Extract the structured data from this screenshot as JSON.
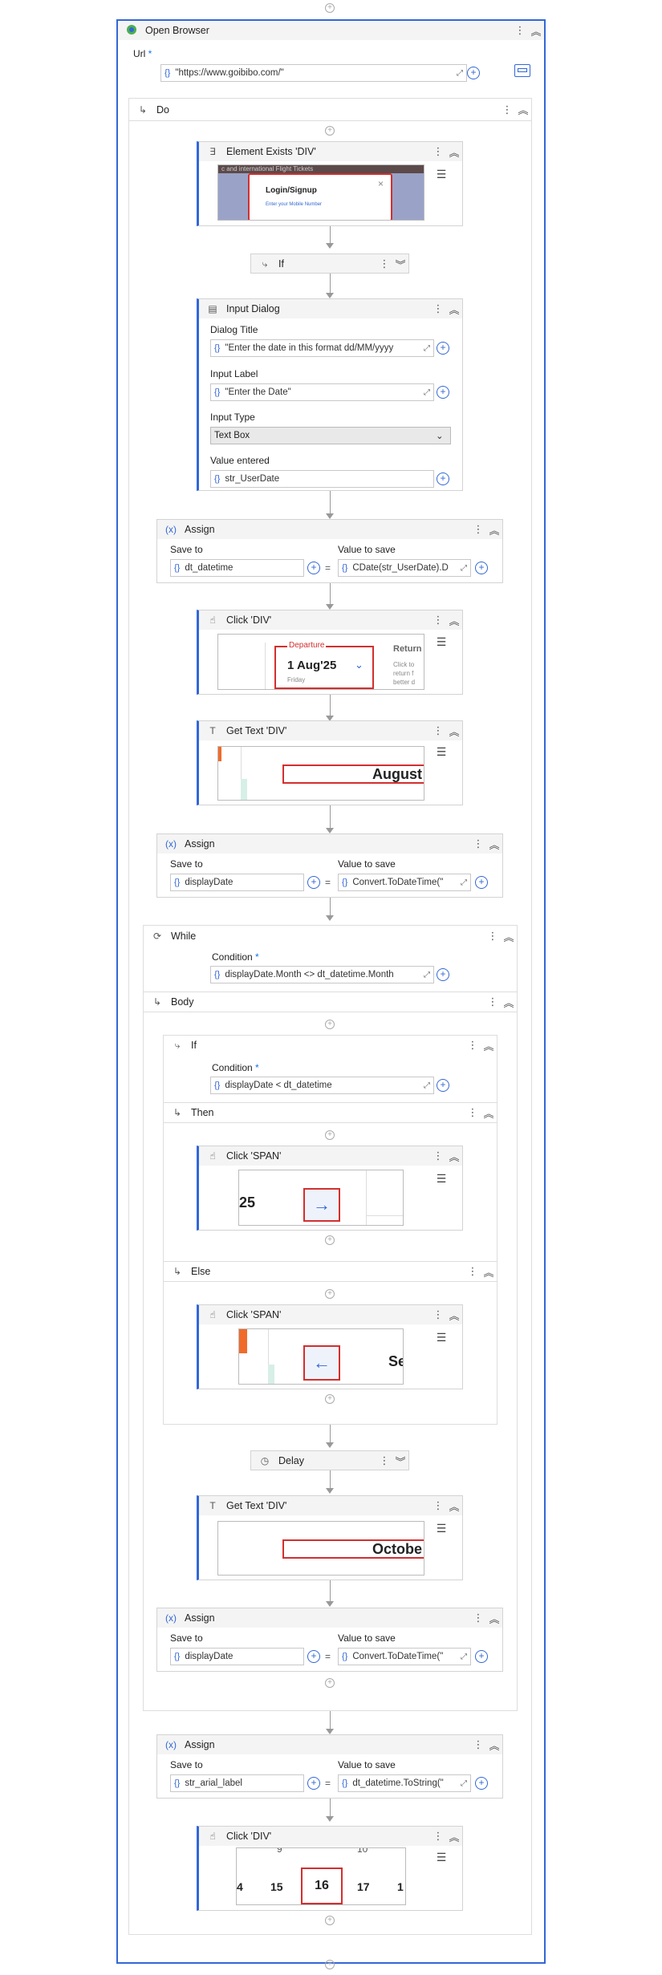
{
  "open_browser": {
    "title": "Open Browser",
    "url_label": "Url",
    "url_value": "\"https://www.goibibo.com/\""
  },
  "do_scope": {
    "label": "Do"
  },
  "element_exists": {
    "title": "Element Exists 'DIV'",
    "preview_login": "Login/Signup",
    "preview_mobile": "Enter your Mobile Number",
    "preview_banner": "c and international Flight Tickets"
  },
  "if1": {
    "title": "If"
  },
  "input_dialog": {
    "title": "Input Dialog",
    "dialog_title_label": "Dialog Title",
    "dialog_title_value": "\"Enter the date in this format dd/MM/yyyy",
    "input_label_label": "Input Label",
    "input_label_value": "\"Enter the Date\"",
    "input_type_label": "Input Type",
    "input_type_value": "Text Box",
    "value_entered_label": "Value entered",
    "value_entered_value": "str_UserDate"
  },
  "assign1": {
    "title": "Assign",
    "save_to_label": "Save to",
    "save_to_value": "dt_datetime",
    "value_label": "Value to save",
    "value_value": "CDate(str_UserDate).D"
  },
  "click_div1": {
    "title": "Click 'DIV'",
    "preview_departure": "Departure",
    "preview_date": "1 Aug'25",
    "preview_day": "Friday",
    "preview_return": "Return",
    "preview_return_sub": "Click to return f better d"
  },
  "get_text1": {
    "title": "Get Text 'DIV'",
    "preview_text": "August"
  },
  "assign2": {
    "title": "Assign",
    "save_to_label": "Save to",
    "save_to_value": "displayDate",
    "value_label": "Value to save",
    "value_value": "Convert.ToDateTime(\""
  },
  "while": {
    "title": "While",
    "condition_label": "Condition",
    "condition_value": "displayDate.Month <> dt_datetime.Month"
  },
  "body": {
    "label": "Body"
  },
  "if2": {
    "title": "If",
    "condition_label": "Condition",
    "condition_value": "displayDate < dt_datetime",
    "then_label": "Then",
    "else_label": "Else"
  },
  "click_span1": {
    "title": "Click 'SPAN'",
    "preview_text": "25"
  },
  "click_span2": {
    "title": "Click 'SPAN'",
    "preview_text": "Se"
  },
  "delay": {
    "title": "Delay"
  },
  "get_text2": {
    "title": "Get Text 'DIV'",
    "preview_text": "Octobe"
  },
  "assign3": {
    "title": "Assign",
    "save_to_label": "Save to",
    "save_to_value": "displayDate",
    "value_label": "Value to save",
    "value_value": "Convert.ToDateTime(\""
  },
  "assign4": {
    "title": "Assign",
    "save_to_label": "Save to",
    "save_to_value": "str_arial_label",
    "value_label": "Value to save",
    "value_value": "dt_datetime.ToString(\""
  },
  "click_div2": {
    "title": "Click 'DIV'",
    "preview_nums": [
      "4",
      "15",
      "16",
      "17",
      "1"
    ],
    "preview_top": [
      "9",
      "10"
    ]
  },
  "symbols": {
    "dots": "⋮",
    "collapse": "︽",
    "expand": "︾",
    "plus": "+",
    "braces": "{}",
    "expander": "⤢",
    "equals": "=",
    "menu": "☰",
    "caret": "⌄",
    "scope_arrow": "↳",
    "star": "*",
    "close": "×",
    "arrow_right": "→",
    "arrow_left": "←",
    "assign_icon": "(x)"
  },
  "colors": {
    "accent": "#3367d6",
    "highlight": "#d32f2f"
  }
}
